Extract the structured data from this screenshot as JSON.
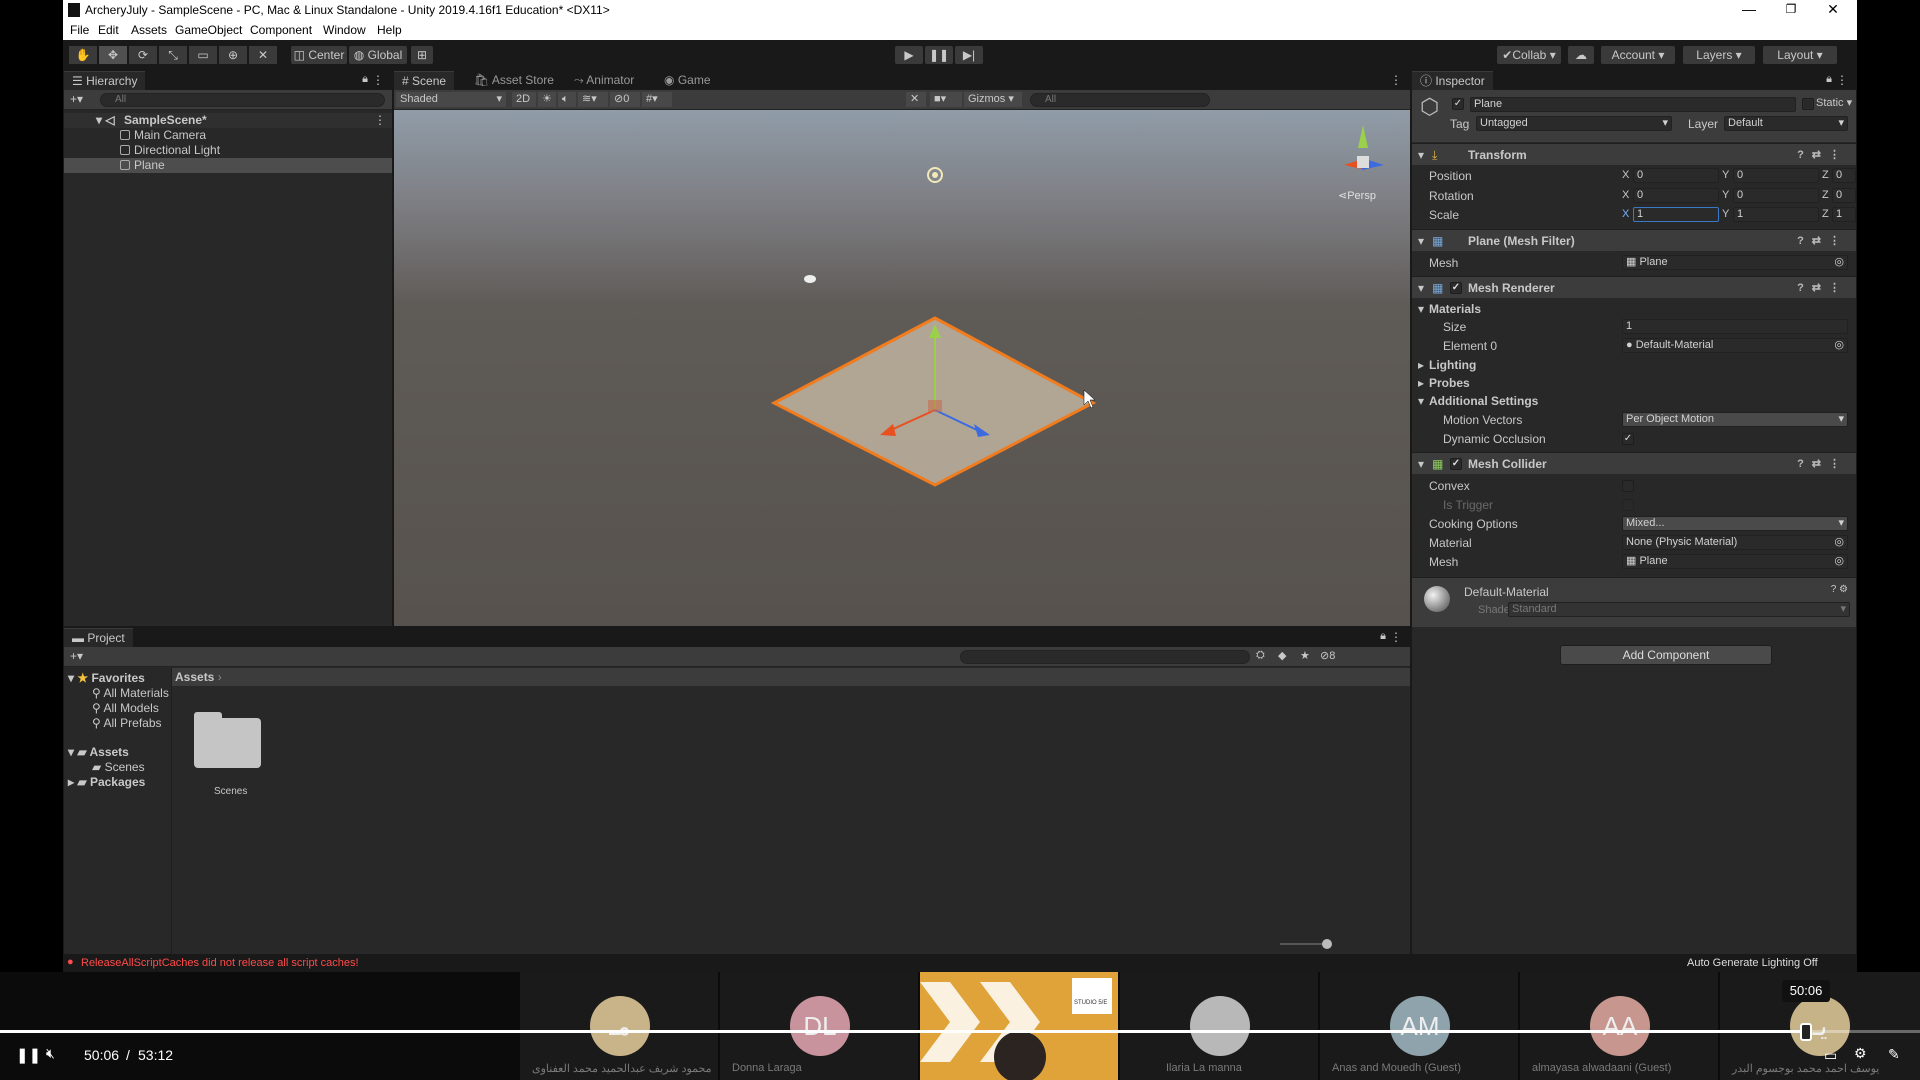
{
  "window": {
    "title": "ArcheryJuly - SampleScene - PC, Mac & Linux Standalone - Unity 2019.4.16f1 Education* <DX11>",
    "minimize": "—",
    "restore": "❐",
    "close": "✕"
  },
  "menu": [
    "File",
    "Edit",
    "Assets",
    "GameObject",
    "Component",
    "Window",
    "Help"
  ],
  "toolbar": {
    "pivot": "Center",
    "space": "Global",
    "collab": "Collab",
    "account": "Account",
    "layers": "Layers",
    "layout": "Layout"
  },
  "hierarchy": {
    "tab": "Hierarchy",
    "search_placeholder": "All",
    "scene": "SampleScene*",
    "items": [
      "Main Camera",
      "Directional Light",
      "Plane"
    ]
  },
  "scene": {
    "tabs": [
      "Scene",
      "Asset Store",
      "Animator",
      "Game"
    ],
    "shading": "Shaded",
    "mode_2d": "2D",
    "hidden_count": "0",
    "gizmos": "Gizmos",
    "search_placeholder": "All",
    "projection": "Persp"
  },
  "inspector": {
    "tab": "Inspector",
    "object_name": "Plane",
    "static": "Static",
    "tag_label": "Tag",
    "tag_value": "Untagged",
    "layer_label": "Layer",
    "layer_value": "Default",
    "transform": {
      "title": "Transform",
      "position_label": "Position",
      "rotation_label": "Rotation",
      "scale_label": "Scale",
      "position": {
        "x": "0",
        "y": "0",
        "z": "0"
      },
      "rotation": {
        "x": "0",
        "y": "0",
        "z": "0"
      },
      "scale": {
        "x": "1",
        "y": "1",
        "z": "1"
      }
    },
    "mesh_filter": {
      "title": "Plane (Mesh Filter)",
      "mesh_label": "Mesh",
      "mesh_value": "Plane"
    },
    "mesh_renderer": {
      "title": "Mesh Renderer",
      "materials": "Materials",
      "size_label": "Size",
      "size_value": "1",
      "element0_label": "Element 0",
      "element0_value": "Default-Material",
      "lighting": "Lighting",
      "probes": "Probes",
      "additional": "Additional Settings",
      "motion_vectors_label": "Motion Vectors",
      "motion_vectors_value": "Per Object Motion",
      "dynamic_occlusion_label": "Dynamic Occlusion"
    },
    "mesh_collider": {
      "title": "Mesh Collider",
      "convex": "Convex",
      "is_trigger": "Is Trigger",
      "cooking_label": "Cooking Options",
      "cooking_value": "Mixed...",
      "material_label": "Material",
      "material_value": "None (Physic Material)",
      "mesh_label": "Mesh",
      "mesh_value": "Plane"
    },
    "material": {
      "name": "Default-Material",
      "shader_label": "Shader",
      "shader_value": "Standard"
    },
    "add_component": "Add Component"
  },
  "project": {
    "tab": "Project",
    "favorites": "Favorites",
    "fav_items": [
      "All Materials",
      "All Models",
      "All Prefabs"
    ],
    "assets": "Assets",
    "scenes": "Scenes",
    "packages": "Packages",
    "breadcrumb": "Assets",
    "folder_label": "Scenes",
    "hidden_count": "8"
  },
  "status": {
    "error": "ReleaseAllScriptCaches did not release all script caches!",
    "lighting": "Auto Generate Lighting Off"
  },
  "player": {
    "current_time": "50:06",
    "total_time": "53:12",
    "tooltip_time": "50:06",
    "progress": 0.9417,
    "participants": [
      {
        "name": "محمود شريف عبدالحميد محمد العفناوى",
        "initials": "مـ",
        "color": "#c9b48a"
      },
      {
        "name": "Donna Laraga",
        "initials": "DL",
        "color": "#c8939c"
      },
      {
        "name": "",
        "initials": "",
        "color": "#e0a33a"
      },
      {
        "name": "Ilaria  La manna",
        "initials": "",
        "color": "#b8b8b8"
      },
      {
        "name": "Anas and Mouedh (Guest)",
        "initials": "AM",
        "color": "#8fa3ad"
      },
      {
        "name": "almayasa alwadaani (Guest)",
        "initials": "AA",
        "color": "#c7968f"
      },
      {
        "name": "يوسف احمد محمد بوجسوم البدر",
        "initials": "يـ",
        "color": "#c6b387"
      }
    ],
    "logo_text": "STUDIO 5/E"
  }
}
